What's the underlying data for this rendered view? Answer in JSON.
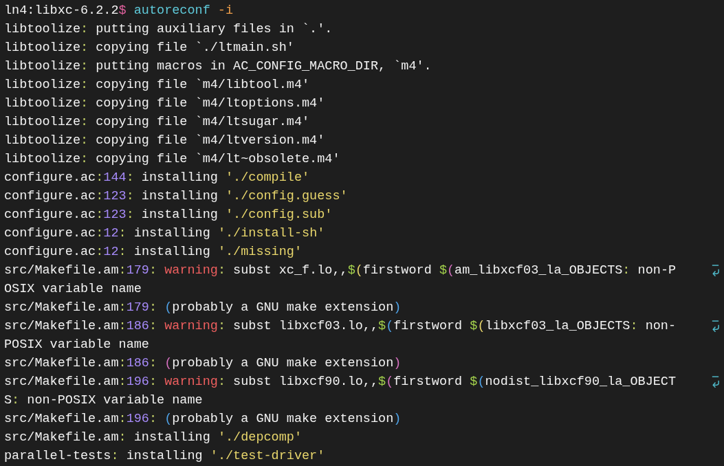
{
  "terminal": {
    "lines": [
      {
        "wrapped": false,
        "segments": [
          {
            "text": "ln4:libxc-6.2.2"
          },
          {
            "text": "$",
            "color": "#e0619d"
          },
          {
            "text": " autoreconf",
            "color": "#5fc9d9"
          },
          {
            "text": " -i",
            "color": "#f0a04b"
          }
        ]
      },
      {
        "wrapped": false,
        "segments": [
          {
            "text": "libtoolize"
          },
          {
            "text": ":",
            "color": "#c5d36a"
          },
          {
            "text": " putting auxiliary files in `.'."
          }
        ]
      },
      {
        "wrapped": false,
        "segments": [
          {
            "text": "libtoolize"
          },
          {
            "text": ":",
            "color": "#c5d36a"
          },
          {
            "text": " copying file `./ltmain.sh'"
          }
        ]
      },
      {
        "wrapped": false,
        "segments": [
          {
            "text": "libtoolize"
          },
          {
            "text": ":",
            "color": "#c5d36a"
          },
          {
            "text": " putting macros in AC_CONFIG_MACRO_DIR, `m4'."
          }
        ]
      },
      {
        "wrapped": false,
        "segments": [
          {
            "text": "libtoolize"
          },
          {
            "text": ":",
            "color": "#c5d36a"
          },
          {
            "text": " copying file `m4/libtool.m4'"
          }
        ]
      },
      {
        "wrapped": false,
        "segments": [
          {
            "text": "libtoolize"
          },
          {
            "text": ":",
            "color": "#c5d36a"
          },
          {
            "text": " copying file `m4/ltoptions.m4'"
          }
        ]
      },
      {
        "wrapped": false,
        "segments": [
          {
            "text": "libtoolize"
          },
          {
            "text": ":",
            "color": "#c5d36a"
          },
          {
            "text": " copying file `m4/ltsugar.m4'"
          }
        ]
      },
      {
        "wrapped": false,
        "segments": [
          {
            "text": "libtoolize"
          },
          {
            "text": ":",
            "color": "#c5d36a"
          },
          {
            "text": " copying file `m4/ltversion.m4'"
          }
        ]
      },
      {
        "wrapped": false,
        "segments": [
          {
            "text": "libtoolize"
          },
          {
            "text": ":",
            "color": "#c5d36a"
          },
          {
            "text": " copying file `m4/lt~obsolete.m4'"
          }
        ]
      },
      {
        "wrapped": false,
        "segments": [
          {
            "text": "configure.ac"
          },
          {
            "text": ":",
            "color": "#c5d36a"
          },
          {
            "text": "144",
            "color": "#a78bfa"
          },
          {
            "text": ":",
            "color": "#c5d36a"
          },
          {
            "text": " installing "
          },
          {
            "text": "'./compile'",
            "color": "#e8d66c"
          }
        ]
      },
      {
        "wrapped": false,
        "segments": [
          {
            "text": "configure.ac"
          },
          {
            "text": ":",
            "color": "#c5d36a"
          },
          {
            "text": "123",
            "color": "#a78bfa"
          },
          {
            "text": ":",
            "color": "#c5d36a"
          },
          {
            "text": " installing "
          },
          {
            "text": "'./config.guess'",
            "color": "#e8d66c"
          }
        ]
      },
      {
        "wrapped": false,
        "segments": [
          {
            "text": "configure.ac"
          },
          {
            "text": ":",
            "color": "#c5d36a"
          },
          {
            "text": "123",
            "color": "#a78bfa"
          },
          {
            "text": ":",
            "color": "#c5d36a"
          },
          {
            "text": " installing "
          },
          {
            "text": "'./config.sub'",
            "color": "#e8d66c"
          }
        ]
      },
      {
        "wrapped": false,
        "segments": [
          {
            "text": "configure.ac"
          },
          {
            "text": ":",
            "color": "#c5d36a"
          },
          {
            "text": "12",
            "color": "#a78bfa"
          },
          {
            "text": ":",
            "color": "#c5d36a"
          },
          {
            "text": " installing "
          },
          {
            "text": "'./install-sh'",
            "color": "#e8d66c"
          }
        ]
      },
      {
        "wrapped": false,
        "segments": [
          {
            "text": "configure.ac"
          },
          {
            "text": ":",
            "color": "#c5d36a"
          },
          {
            "text": "12",
            "color": "#a78bfa"
          },
          {
            "text": ":",
            "color": "#c5d36a"
          },
          {
            "text": " installing "
          },
          {
            "text": "'./missing'",
            "color": "#e8d66c"
          }
        ]
      },
      {
        "wrapped": true,
        "segments": [
          {
            "text": "src/Makefile.am"
          },
          {
            "text": ":",
            "color": "#c5d36a"
          },
          {
            "text": "179",
            "color": "#a78bfa"
          },
          {
            "text": ": ",
            "color": "#c5d36a"
          },
          {
            "text": "warning",
            "color": "#ef5f5f"
          },
          {
            "text": ":",
            "color": "#c5d36a"
          },
          {
            "text": " subst xc_f.lo,,"
          },
          {
            "text": "$",
            "color": "#a3d14c"
          },
          {
            "text": "(",
            "color": "#e8d66c"
          },
          {
            "text": "firstword "
          },
          {
            "text": "$",
            "color": "#a3d14c"
          },
          {
            "text": "(",
            "color": "#d670c0"
          },
          {
            "text": "am_libxcf03_la_OBJECTS"
          },
          {
            "text": ":",
            "color": "#c5d36a"
          },
          {
            "text": " non-P"
          }
        ]
      },
      {
        "wrapped": false,
        "segments": [
          {
            "text": "OSIX variable name"
          }
        ]
      },
      {
        "wrapped": false,
        "segments": [
          {
            "text": "src/Makefile.am"
          },
          {
            "text": ":",
            "color": "#c5d36a"
          },
          {
            "text": "179",
            "color": "#a78bfa"
          },
          {
            "text": ": ",
            "color": "#c5d36a"
          },
          {
            "text": "(",
            "color": "#4fa3e8"
          },
          {
            "text": "probably a GNU make extension"
          },
          {
            "text": ")",
            "color": "#4fa3e8"
          }
        ]
      },
      {
        "wrapped": true,
        "segments": [
          {
            "text": "src/Makefile.am"
          },
          {
            "text": ":",
            "color": "#c5d36a"
          },
          {
            "text": "186",
            "color": "#a78bfa"
          },
          {
            "text": ": ",
            "color": "#c5d36a"
          },
          {
            "text": "warning",
            "color": "#ef5f5f"
          },
          {
            "text": ":",
            "color": "#c5d36a"
          },
          {
            "text": " subst libxcf03.lo,,"
          },
          {
            "text": "$",
            "color": "#a3d14c"
          },
          {
            "text": "(",
            "color": "#4fa3e8"
          },
          {
            "text": "firstword "
          },
          {
            "text": "$",
            "color": "#a3d14c"
          },
          {
            "text": "(",
            "color": "#e8d66c"
          },
          {
            "text": "libxcf03_la_OBJECTS"
          },
          {
            "text": ":",
            "color": "#c5d36a"
          },
          {
            "text": " non-"
          }
        ]
      },
      {
        "wrapped": false,
        "segments": [
          {
            "text": "POSIX variable name"
          }
        ]
      },
      {
        "wrapped": false,
        "segments": [
          {
            "text": "src/Makefile.am"
          },
          {
            "text": ":",
            "color": "#c5d36a"
          },
          {
            "text": "186",
            "color": "#a78bfa"
          },
          {
            "text": ": ",
            "color": "#c5d36a"
          },
          {
            "text": "(",
            "color": "#d670c0"
          },
          {
            "text": "probably a GNU make extension"
          },
          {
            "text": ")",
            "color": "#d670c0"
          }
        ]
      },
      {
        "wrapped": true,
        "segments": [
          {
            "text": "src/Makefile.am"
          },
          {
            "text": ":",
            "color": "#c5d36a"
          },
          {
            "text": "196",
            "color": "#a78bfa"
          },
          {
            "text": ": ",
            "color": "#c5d36a"
          },
          {
            "text": "warning",
            "color": "#ef5f5f"
          },
          {
            "text": ":",
            "color": "#c5d36a"
          },
          {
            "text": " subst libxcf90.lo,,"
          },
          {
            "text": "$",
            "color": "#a3d14c"
          },
          {
            "text": "(",
            "color": "#d670c0"
          },
          {
            "text": "firstword "
          },
          {
            "text": "$",
            "color": "#a3d14c"
          },
          {
            "text": "(",
            "color": "#4fa3e8"
          },
          {
            "text": "nodist_libxcf90_la_OBJECT"
          }
        ]
      },
      {
        "wrapped": false,
        "segments": [
          {
            "text": "S"
          },
          {
            "text": ":",
            "color": "#c5d36a"
          },
          {
            "text": " non-POSIX variable name"
          }
        ]
      },
      {
        "wrapped": false,
        "segments": [
          {
            "text": "src/Makefile.am"
          },
          {
            "text": ":",
            "color": "#c5d36a"
          },
          {
            "text": "196",
            "color": "#a78bfa"
          },
          {
            "text": ": ",
            "color": "#c5d36a"
          },
          {
            "text": "(",
            "color": "#4fa3e8"
          },
          {
            "text": "probably a GNU make extension"
          },
          {
            "text": ")",
            "color": "#4fa3e8"
          }
        ]
      },
      {
        "wrapped": false,
        "segments": [
          {
            "text": "src/Makefile.am"
          },
          {
            "text": ":",
            "color": "#c5d36a"
          },
          {
            "text": " installing "
          },
          {
            "text": "'./depcomp'",
            "color": "#e8d66c"
          }
        ]
      },
      {
        "wrapped": false,
        "segments": [
          {
            "text": "parallel-tests"
          },
          {
            "text": ":",
            "color": "#c5d36a"
          },
          {
            "text": " installing "
          },
          {
            "text": "'./test-driver'",
            "color": "#e8d66c"
          }
        ]
      }
    ]
  }
}
